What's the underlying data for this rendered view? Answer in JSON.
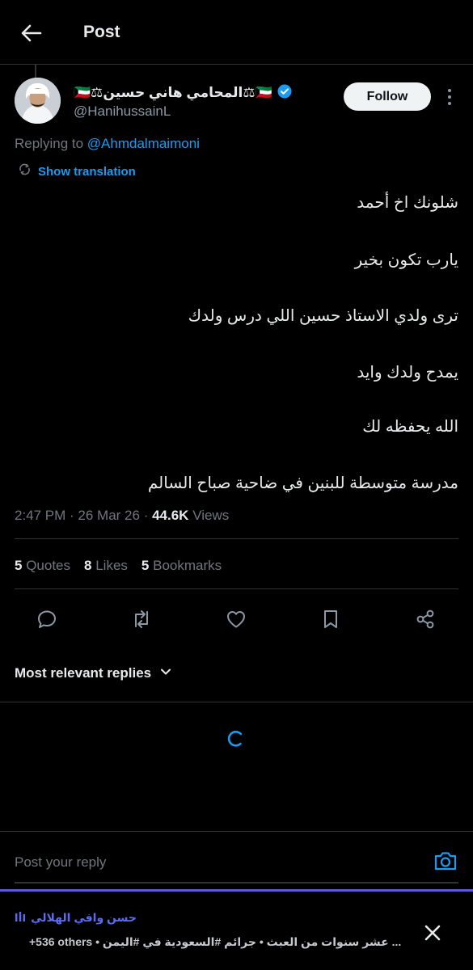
{
  "header": {
    "title": "Post"
  },
  "tweet": {
    "display_name": "🇰🇼⚖المحامي هاني حسين⚖🇰🇼",
    "handle": "@HanihussainL",
    "follow_label": "Follow",
    "replying_prefix": "Replying to",
    "replying_to": "@Ahmdalmaimoni",
    "show_translation": "Show translation",
    "lines": [
      "شلونك اخ أحمد",
      "يارب تكون بخير",
      "ترى ولدي الاستاذ حسين اللي درس ولدك",
      "يمدح ولدك وايد",
      "الله يحفظه لك",
      "مدرسة متوسطة للبنين في ضاحية صباح السالم"
    ],
    "time": "2:47 PM",
    "date": "26 Mar 26",
    "views_count": "44.6K",
    "views_label": "Views"
  },
  "stats": {
    "quotes_count": "5",
    "quotes_label": "Quotes",
    "likes_count": "8",
    "likes_label": "Likes",
    "bookmarks_count": "5",
    "bookmarks_label": "Bookmarks"
  },
  "replies": {
    "sort_label": "Most relevant replies"
  },
  "reply_box": {
    "placeholder": "Post your reply"
  },
  "banner": {
    "title": "حسن وافي الهلالي",
    "subtitle": "+536 others • عشر سنوات من العبث • جرائم #السعودية في #اليمن ..."
  },
  "colors": {
    "accent": "#1d9bf0",
    "background": "#000000",
    "muted": "#71767b",
    "banner_accent": "#5b6cf0"
  }
}
